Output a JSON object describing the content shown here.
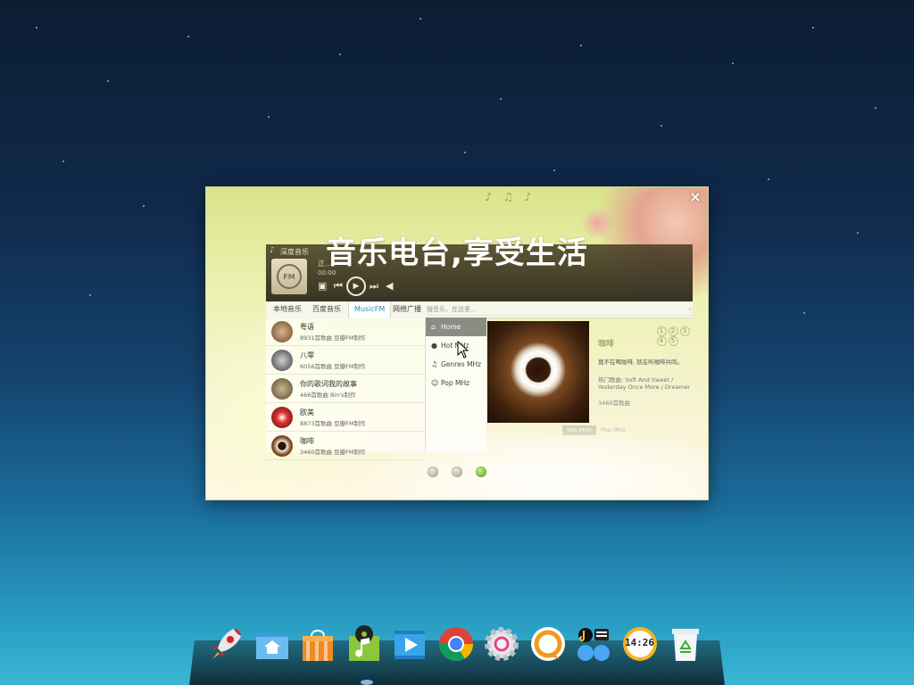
{
  "dialog": {
    "headline": "音乐电台,享受生活",
    "close_label": "×",
    "pagination": {
      "total": 3,
      "active_index": 2
    }
  },
  "player": {
    "app_title": "深度音乐",
    "now_playing": "正...",
    "elapsed": "00:00",
    "cover_label": "FM",
    "controls": [
      "repeat",
      "previous",
      "play",
      "next",
      "volume"
    ],
    "tabs": [
      {
        "label": "本地音乐",
        "active": false
      },
      {
        "label": "百度音乐",
        "active": false
      },
      {
        "label": "MusicFM",
        "active": true
      },
      {
        "label": "网络广播",
        "active": false
      }
    ],
    "search_placeholder": "搜音乐、在这里...",
    "channels": [
      {
        "name": "粤语",
        "info": "8931首歌曲 豆瓣FM制作"
      },
      {
        "name": "八零",
        "info": "6056首歌曲 豆瓣FM制作"
      },
      {
        "name": "你的歌词我的故事",
        "info": "466首歌曲 Bin's制作"
      },
      {
        "name": "欧美",
        "info": "8873首歌曲 豆瓣FM制作"
      },
      {
        "name": "咖啡",
        "info": "3460首歌曲 豆瓣FM制作"
      }
    ],
    "nav": [
      {
        "label": "Home",
        "icon": "home-icon",
        "active": true
      },
      {
        "label": "Hot MHz",
        "icon": "hot-icon",
        "active": false
      },
      {
        "label": "Genres MHz",
        "icon": "music-note-icon",
        "active": false
      },
      {
        "label": "Pop MHz",
        "icon": "smile-icon",
        "active": false
      }
    ],
    "detail": {
      "pager": [
        "1",
        "2",
        "3",
        "4",
        "5"
      ],
      "title": "咖啡",
      "description": "我不在喝咖啡, 就在听咖啡共鸣。",
      "songs_label": "热门歌曲: Soft And Sweet / Yesterday Once More / Dreamer",
      "count": "3460首歌曲"
    },
    "bottom_buttons": [
      "Hot MHz",
      "Pop MHz"
    ]
  },
  "dock": {
    "apps": [
      {
        "name": "launcher",
        "icon": "rocket-icon"
      },
      {
        "name": "file-manager",
        "icon": "home-folder-icon"
      },
      {
        "name": "software-center",
        "icon": "shopping-bag-icon"
      },
      {
        "name": "music",
        "icon": "music-note-icon"
      },
      {
        "name": "video-player",
        "icon": "film-play-icon"
      },
      {
        "name": "browser",
        "icon": "chrome-icon"
      },
      {
        "name": "settings",
        "icon": "gear-icon"
      },
      {
        "name": "chat",
        "icon": "chat-ring-icon"
      },
      {
        "name": "multi-app",
        "icon": "app-group-icon"
      },
      {
        "name": "clock",
        "icon": "clock-icon"
      },
      {
        "name": "trash",
        "icon": "trash-recycle-icon"
      }
    ],
    "clock_text": "14:26"
  }
}
